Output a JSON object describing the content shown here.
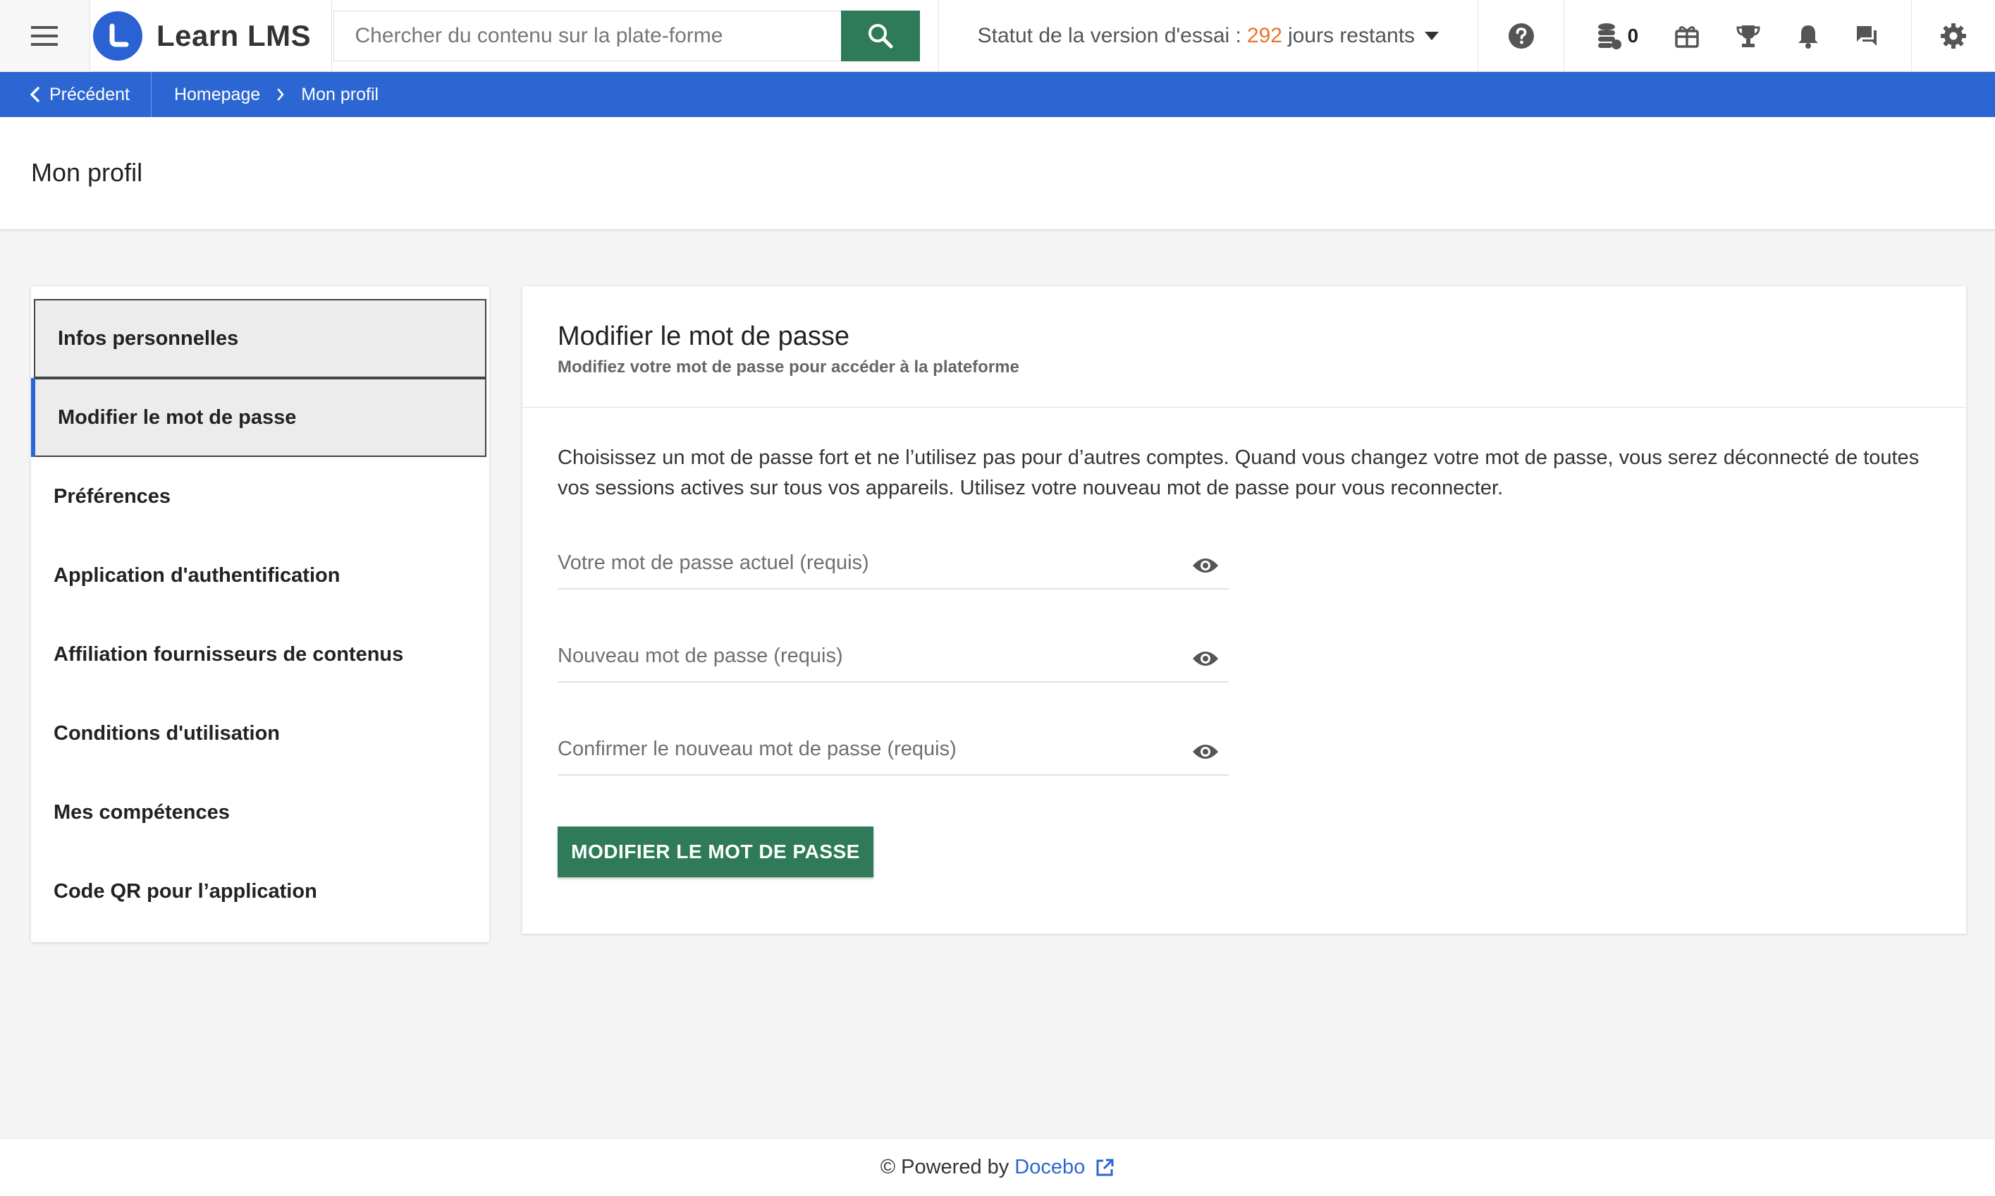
{
  "header": {
    "brand_name": "Learn LMS",
    "search": {
      "placeholder": "Chercher du contenu sur la plate-forme"
    },
    "trial": {
      "prefix": "Statut de la version d'essai :",
      "days": "292",
      "suffix": "jours restants"
    },
    "coins_count": "0",
    "icons": [
      "menu-icon",
      "search-icon",
      "help-icon",
      "coins-icon",
      "gift-icon",
      "trophy-icon",
      "bell-icon",
      "chat-icon",
      "gear-icon"
    ]
  },
  "breadcrumb": {
    "back_label": "Précédent",
    "items": [
      {
        "label": "Homepage"
      },
      {
        "label": "Mon profil"
      }
    ]
  },
  "page": {
    "title": "Mon profil"
  },
  "sidebar": {
    "items": [
      {
        "label": "Infos personnelles"
      },
      {
        "label": "Modifier le mot de passe"
      },
      {
        "label": "Préférences"
      },
      {
        "label": "Application d'authentification"
      },
      {
        "label": "Affiliation fournisseurs de contenus"
      },
      {
        "label": "Conditions d'utilisation"
      },
      {
        "label": "Mes compétences"
      },
      {
        "label": "Code QR pour l’application"
      }
    ]
  },
  "panel": {
    "title": "Modifier le mot de passe",
    "subtitle": "Modifiez votre mot de passe pour accéder à la plateforme",
    "description": "Choisissez un mot de passe fort et ne l’utilisez pas pour d’autres comptes. Quand vous changez votre mot de passe, vous serez déconnecté de toutes vos sessions actives sur tous vos appareils. Utilisez votre nouveau mot de passe pour vous reconnecter.",
    "fields": [
      {
        "placeholder": "Votre mot de passe actuel (requis)",
        "value": ""
      },
      {
        "placeholder": "Nouveau mot de passe (requis)",
        "value": ""
      },
      {
        "placeholder": "Confirmer le nouveau mot de passe (requis)",
        "value": ""
      }
    ],
    "submit_label": "MODIFIER LE MOT DE PASSE"
  },
  "footer": {
    "prefix": "© Powered by",
    "link": "Docebo"
  },
  "colors": {
    "accent_blue": "#2c66d2",
    "primary_green": "#2f7b59",
    "trial_orange": "#e8742b"
  }
}
